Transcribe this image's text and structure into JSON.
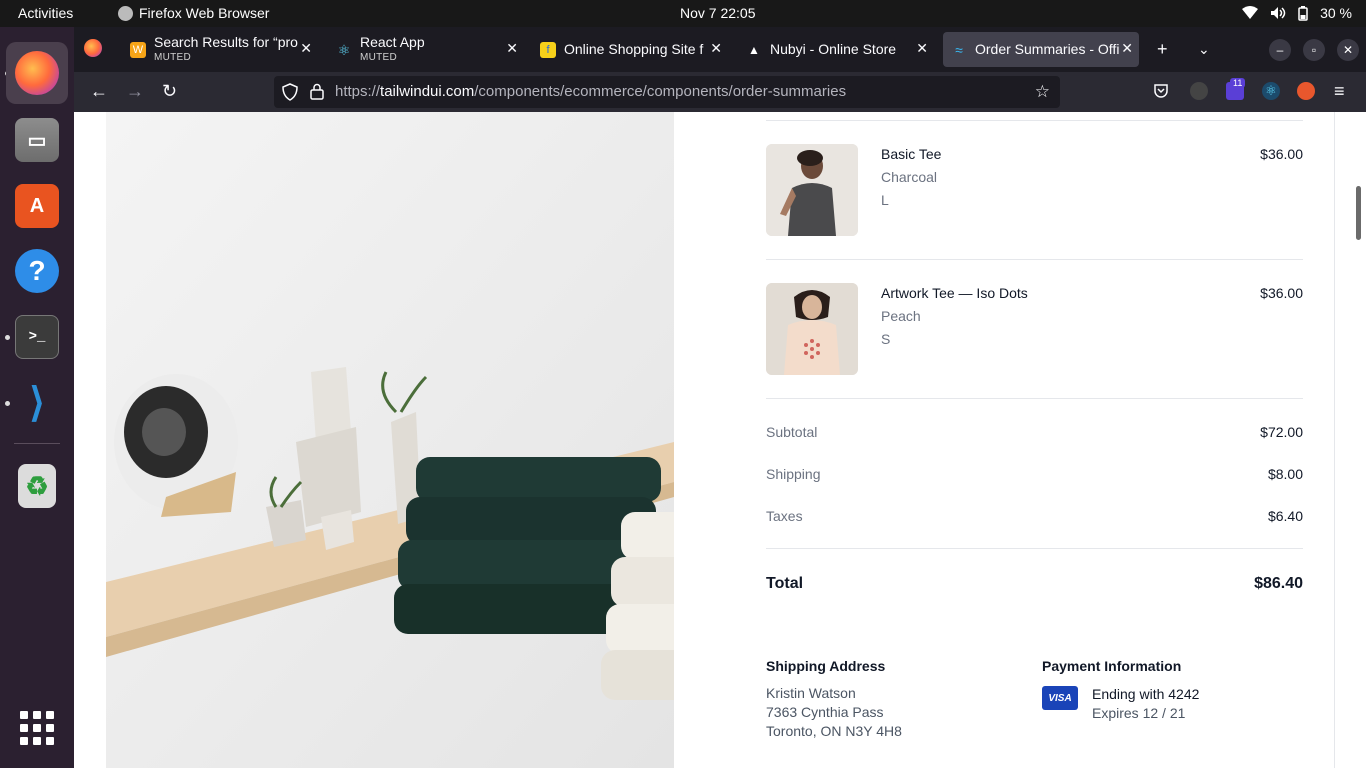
{
  "system": {
    "activities": "Activities",
    "app_name": "Firefox Web Browser",
    "clock": "Nov 7  22:05",
    "battery": "30 %"
  },
  "dock": {
    "items": [
      "firefox-icon",
      "files-icon",
      "app-store-icon",
      "help-icon",
      "terminal-icon",
      "vscode-icon",
      "trash-icon",
      "show-apps-icon"
    ]
  },
  "tabs": [
    {
      "title": "Search Results for “pro",
      "subtitle": "MUTED"
    },
    {
      "title": "React App",
      "subtitle": "MUTED"
    },
    {
      "title": "Online Shopping Site f",
      "subtitle": ""
    },
    {
      "title": "Nubyi - Online Store",
      "subtitle": ""
    },
    {
      "title": "Order Summaries - Offi",
      "subtitle": ""
    }
  ],
  "url": {
    "scheme": "https://",
    "host": "tailwindui.com",
    "path": "/components/ecommerce/components/order-summaries"
  },
  "extensions": {
    "badge": "11"
  },
  "order": {
    "items": [
      {
        "name": "Basic Tee",
        "color": "Charcoal",
        "size": "L",
        "price": "$36.00"
      },
      {
        "name": "Artwork Tee — Iso Dots",
        "color": "Peach",
        "size": "S",
        "price": "$36.00"
      }
    ],
    "subtotal_label": "Subtotal",
    "subtotal": "$72.00",
    "shipping_label": "Shipping",
    "shipping": "$8.00",
    "taxes_label": "Taxes",
    "taxes": "$6.40",
    "total_label": "Total",
    "total": "$86.40"
  },
  "shipping_address": {
    "title": "Shipping Address",
    "name": "Kristin Watson",
    "street": "7363 Cynthia Pass",
    "city": "Toronto, ON N3Y 4H8"
  },
  "payment": {
    "title": "Payment Information",
    "card_brand": "VISA",
    "ending": "Ending with 4242",
    "expires": "Expires 12 / 21"
  }
}
